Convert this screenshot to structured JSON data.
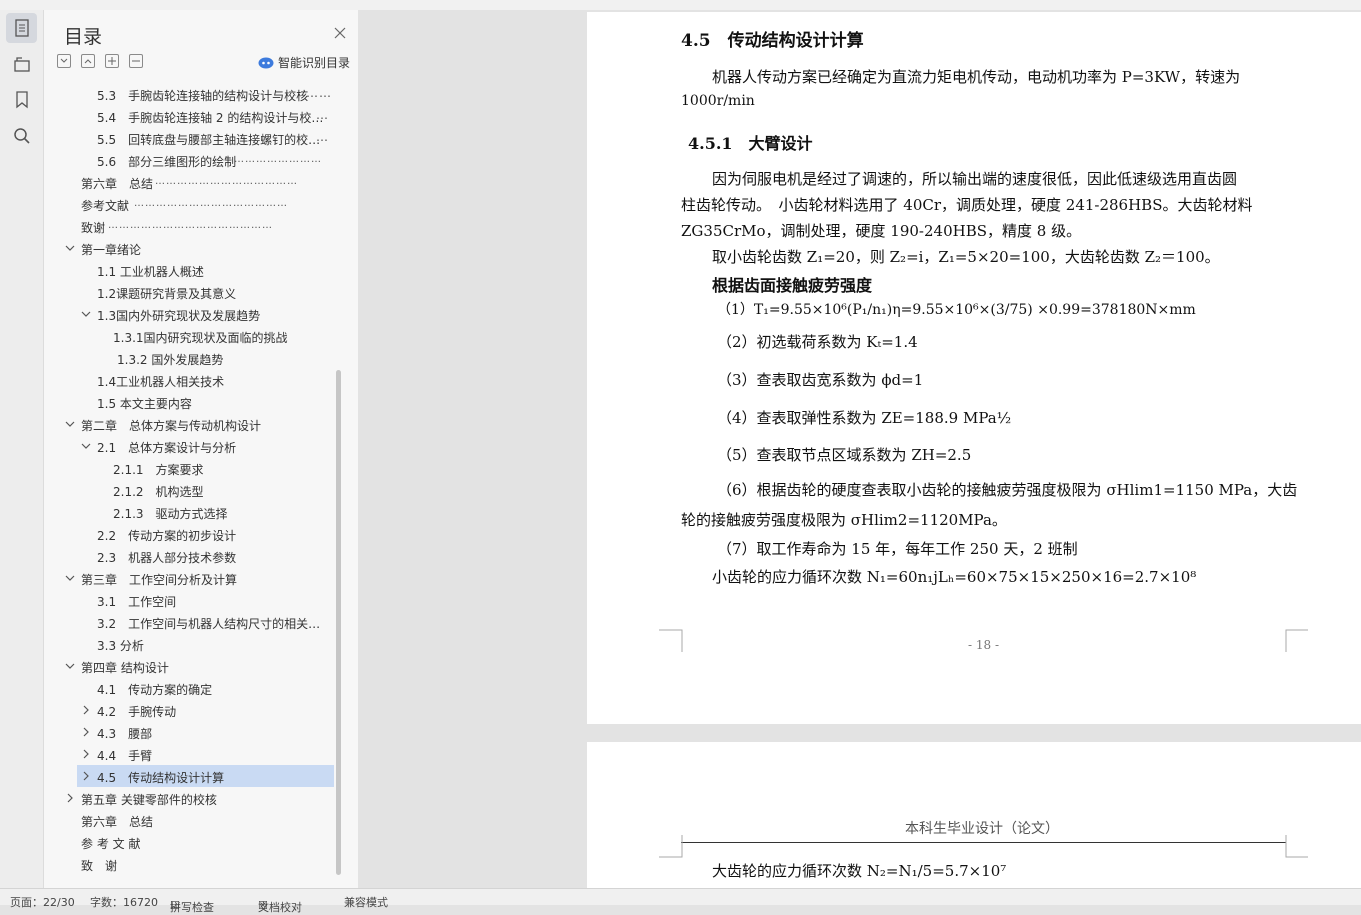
{
  "nav": {
    "title": "目录",
    "smart_toc": "智能识别目录",
    "items": [
      {
        "label": "5.3　手腕齿轮连接轴的结构设计与校核",
        "dots": "……"
      },
      {
        "label": "5.4　手腕齿轮连接轴 2 的结构设计与校…",
        "dots": "…"
      },
      {
        "label": "5.5　回转底盘与腰部主轴连接螺钉的校…",
        "dots": "…"
      },
      {
        "label": "5.6　部分三维图形的绘制",
        "dots": "……………………"
      },
      {
        "label": "第六章　总结",
        "dots": "…………………………………"
      },
      {
        "label": "参考文献",
        "dots": "……………………………………"
      },
      {
        "label": "致谢",
        "dots": "………………………………………"
      },
      {
        "label": "第一章绪论"
      },
      {
        "label": "1.1 工业机器人概述"
      },
      {
        "label": "1.2课题研究背景及其意义"
      },
      {
        "label": "1.3国内外研究现状及发展趋势"
      },
      {
        "label": "1.3.1国内研究现状及面临的挑战"
      },
      {
        "label": "1.3.2 国外发展趋势"
      },
      {
        "label": "1.4工业机器人相关技术"
      },
      {
        "label": "1.5 本文主要内容"
      },
      {
        "label": "第二章　总体方案与传动机构设计"
      },
      {
        "label": "2.1　总体方案设计与分析"
      },
      {
        "label": "2.1.1　方案要求"
      },
      {
        "label": "2.1.2　机构选型"
      },
      {
        "label": "2.1.3　驱动方式选择"
      },
      {
        "label": "2.2　传动方案的初步设计"
      },
      {
        "label": "2.3　机器人部分技术参数"
      },
      {
        "label": "第三章　工作空间分析及计算"
      },
      {
        "label": "3.1　工作空间"
      },
      {
        "label": "3.2　工作空间与机器人结构尺寸的相关…"
      },
      {
        "label": "3.3 分析"
      },
      {
        "label": "第四章 结构设计"
      },
      {
        "label": "4.1　传动方案的确定"
      },
      {
        "label": "4.2　手腕传动"
      },
      {
        "label": "4.3　腰部"
      },
      {
        "label": "4.4　手臂"
      },
      {
        "label": "4.5　传动结构设计计算"
      },
      {
        "label": "第五章 关键零部件的校核"
      },
      {
        "label": "第六章　总结"
      },
      {
        "label": "参 考 文 献"
      },
      {
        "label": "致　谢"
      }
    ]
  },
  "page1": {
    "heading_45": "4.5　传动结构设计计算",
    "para1_line1": "机器人传动方案已经确定为直流力矩电机传动，电动机功率为 P=3KW，转速为",
    "para1_line2": "1000r/min",
    "heading_451": "4.5.1　大臂设计",
    "para2_line1": "因为伺服电机是经过了调速的，所以输出端的速度很低，因此低速级选用直齿圆",
    "para2_line2": "柱齿轮传动。　小齿轮材料选用了 40Cr，调质处理，硬度 241-286HBS。大齿轮材料",
    "para2_line3": "ZG35CrMo，调制处理，硬度 190-240HBS，精度 8 级。",
    "para3": "取小齿轮齿数 Z₁=20，则 Z₂=i，Z₁=5×20=100，大齿轮齿数 Z₂＝100。",
    "bold_heading": "根据齿面接触疲劳强度",
    "item1": "（1）T₁=9.55×10⁶(P₁/n₁)η=9.55×10⁶×(3/75) ×0.99=378180N×mm",
    "item2": "（2）初选载荷系数为 Kₜ=1.4",
    "item3": "（3）查表取齿宽系数为 ϕd=1",
    "item4": "（4）查表取弹性系数为 ZE=188.9 MPa½",
    "item5": "（5）查表取节点区域系数为 ZH=2.5",
    "item6_line1": "（6）根据齿轮的硬度查表取小齿轮的接触疲劳强度极限为 σHlim1=1150 MPa，大齿",
    "item6_line2": "轮的接触疲劳强度极限为 σHlim2=1120MPa。",
    "item7": "（7）取工作寿命为 15 年，每年工作 250 天，2 班制",
    "cycles_small": "小齿轮的应力循环次数 N₁=60n₁jLₕ=60×75×15×250×16=2.7×10⁸",
    "page_number": "- 18 -"
  },
  "page2": {
    "header": "本科生毕业设计（论文）",
    "cycles_large": "大齿轮的应力循环次数 N₂=N₁/5=5.7×10⁷"
  },
  "status": {
    "page": "页面：22/30",
    "words": "字数：16720",
    "spell": "拼写检查",
    "proof": "文档校对",
    "compat": "兼容模式"
  }
}
